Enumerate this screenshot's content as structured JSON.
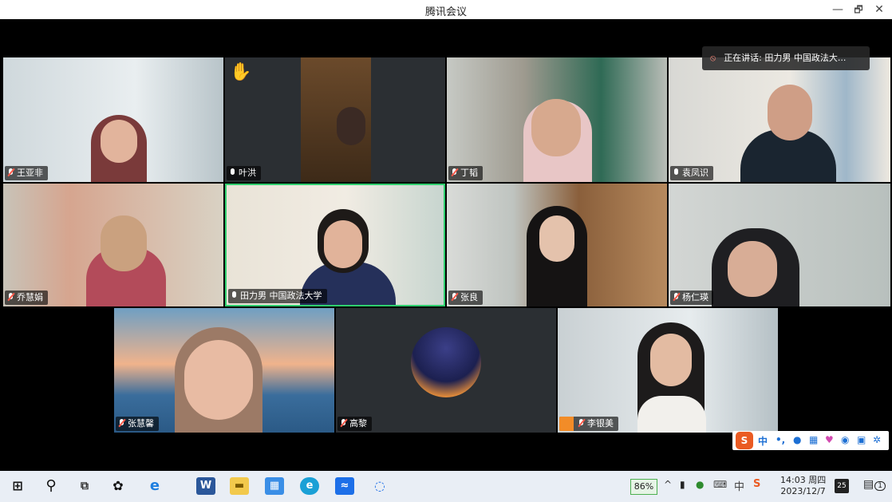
{
  "window": {
    "title": "腾讯会议",
    "controls": {
      "minimize": "—",
      "maximize": "🗗",
      "close": "✕"
    }
  },
  "speaking": {
    "label": "正在讲话:",
    "name": "田力男 中国政法大..."
  },
  "participants": [
    {
      "name": "王亚非",
      "muted": true
    },
    {
      "name": "叶洪",
      "muted": false,
      "hand_raised": true
    },
    {
      "name": "丁韬",
      "muted": true
    },
    {
      "name": "袁凤识",
      "muted": false
    },
    {
      "name": "乔慧娟",
      "muted": true
    },
    {
      "name": "田力男 中国政法大学",
      "muted": false,
      "active_speaker": true
    },
    {
      "name": "张良",
      "muted": true
    },
    {
      "name": "杨仁瑛",
      "muted": true
    },
    {
      "name": "张慧馨",
      "muted": true
    },
    {
      "name": "高黎",
      "muted": true
    },
    {
      "name": "李银美",
      "muted": true
    }
  ],
  "ime": {
    "mode": "中",
    "punct": "•,",
    "logo": "S"
  },
  "taskbar": {
    "battery": "86%",
    "time": "14:03 周四",
    "date": "2023/12/7",
    "ime_indicator": "中",
    "notification_badge": "1",
    "calendar_badge": "25",
    "icons": [
      "windows-start-icon",
      "search-icon",
      "task-view-icon",
      "app-s-icon",
      "ie-icon",
      "word-icon",
      "file-explorer-icon",
      "app-grid-icon",
      "edge-icon",
      "meeting-app-icon",
      "chat-search-icon"
    ]
  },
  "colors": {
    "active_border": "#2fcf6e",
    "muted_mic": "#ff5a4a",
    "hand": "#f7c21a",
    "word_blue": "#2b579a"
  }
}
